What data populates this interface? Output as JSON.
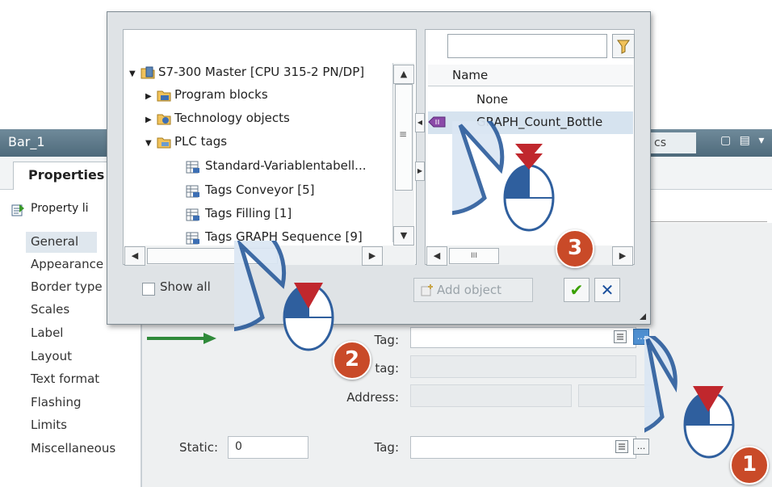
{
  "inspector": {
    "object_title": "Bar_1",
    "tab_partial": "cs",
    "properties_tab": "Properties",
    "property_list_label": "Property li",
    "nav_items": [
      "General",
      "Appearance",
      "Border type",
      "Scales",
      "Label",
      "Layout",
      "Text format",
      "Flashing",
      "Limits",
      "Miscellaneous"
    ],
    "fields": {
      "tag1_label": "Tag:",
      "tag2_label": "tag:",
      "address_label": "Address:",
      "static_label": "Static:",
      "static_value": "0",
      "tag3_label": "Tag:",
      "browse_label": "..."
    }
  },
  "popup": {
    "tree": [
      {
        "label": "S7-300 Master [CPU 315-2 PN/DP]",
        "icon": "cpu-icon",
        "expanded": true
      },
      {
        "label": "Program blocks",
        "icon": "program-blocks-icon",
        "expanded": false
      },
      {
        "label": "Technology objects",
        "icon": "technology-objects-icon",
        "expanded": false
      },
      {
        "label": "PLC tags",
        "icon": "folder-icon",
        "expanded": true
      },
      {
        "label": "Standard-Variablentabell...",
        "icon": "tag-table-icon"
      },
      {
        "label": "Tags Conveyor [5]",
        "icon": "tag-table-icon"
      },
      {
        "label": "Tags Filling [1]",
        "icon": "tag-table-icon"
      },
      {
        "label": "Tags GRAPH Sequence [9]",
        "icon": "tag-table-icon"
      }
    ],
    "list_header": "Name",
    "list_items": [
      "None",
      "GRAPH_Count_Bottle"
    ],
    "list_scroll_label": "III",
    "show_all_label": "Show all",
    "add_object_label": "Add object",
    "filter_value": "",
    "ok_symbol": "✔",
    "cancel_symbol": "✕"
  },
  "callouts": [
    "1",
    "2",
    "3"
  ],
  "colors": {
    "accent_red": "#c94a28",
    "mouse_blue": "#2f5f9e",
    "title_blue": "#5a7687"
  }
}
